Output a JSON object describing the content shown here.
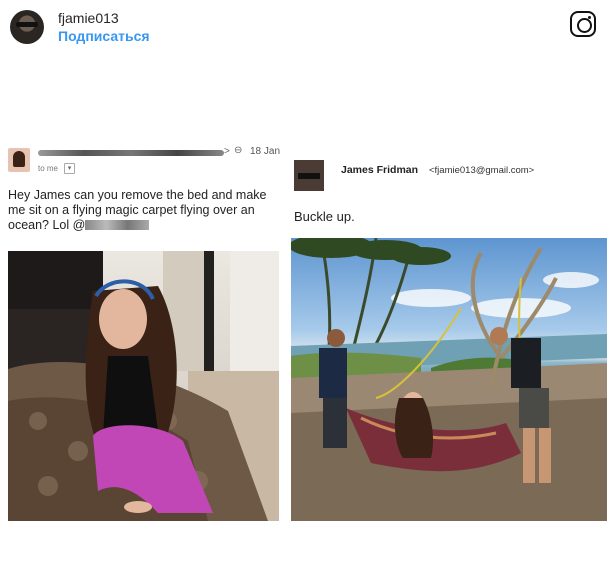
{
  "header": {
    "username": "fjamie013",
    "follow_label": "Подписаться"
  },
  "left_email": {
    "date": "18 Jan",
    "to_me": "to me",
    "caret": "▾",
    "message": "Hey James can you remove the bed and make me sit on a flying magic carpet flying over an ocean? Lol @"
  },
  "right_email": {
    "sender_name": "James Fridman",
    "sender_email": "<fjamie013@gmail.com>",
    "message": "Buckle up."
  },
  "colors": {
    "follow": "#3897f0",
    "rug": "#7a2e3a",
    "sea": "#6f9eb1",
    "sky": "#5e95d0"
  }
}
